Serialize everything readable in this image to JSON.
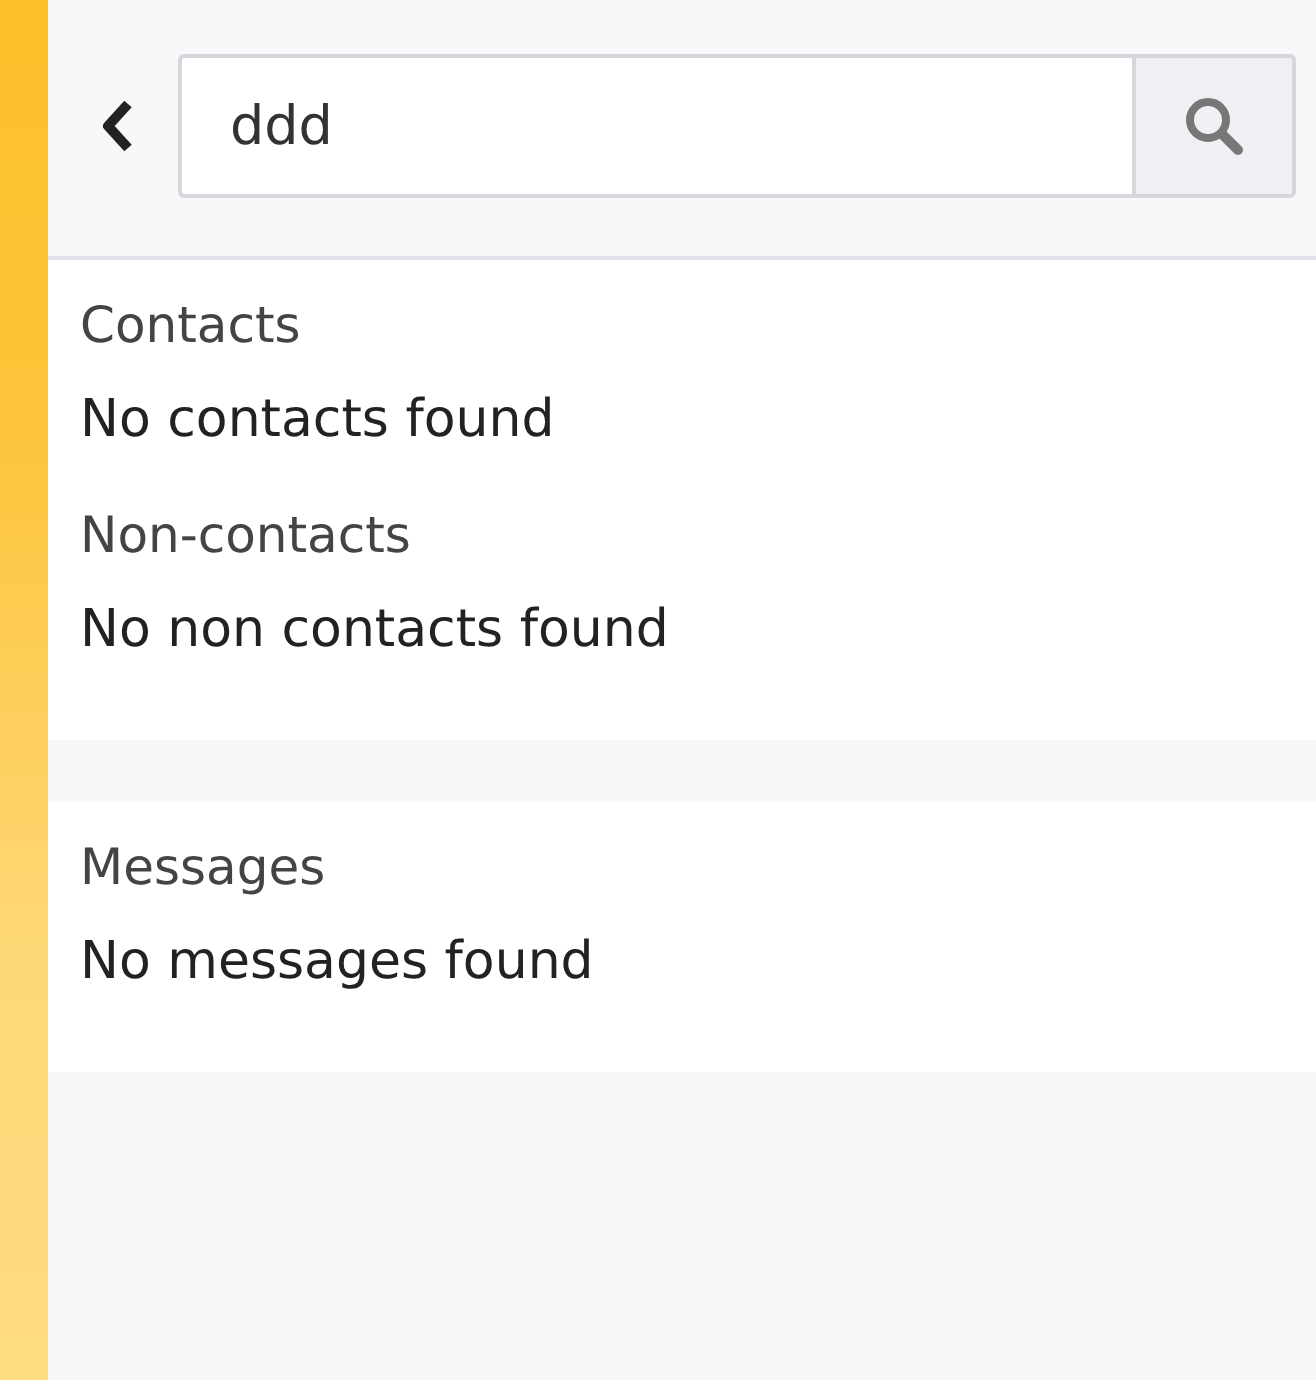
{
  "search": {
    "value": "ddd"
  },
  "groups": [
    {
      "sections": [
        {
          "title": "Contacts",
          "empty_text": "No contacts found"
        },
        {
          "title": "Non-contacts",
          "empty_text": "No non contacts found"
        }
      ]
    },
    {
      "sections": [
        {
          "title": "Messages",
          "empty_text": "No messages found"
        }
      ]
    }
  ]
}
